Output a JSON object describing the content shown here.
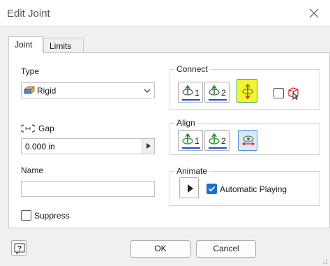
{
  "window": {
    "title": "Edit Joint"
  },
  "tabs": [
    {
      "label": "Joint",
      "active": true
    },
    {
      "label": "Limits",
      "active": false
    }
  ],
  "type_section": {
    "label": "Type",
    "selected": "Rigid"
  },
  "gap_section": {
    "label": "Gap",
    "value": "0.000 in"
  },
  "name_section": {
    "label": "Name",
    "value": ""
  },
  "suppress": {
    "label": "Suppress",
    "checked": false
  },
  "connect": {
    "label": "Connect",
    "buttons": [
      {
        "label": "1",
        "icon": "origin-1-icon"
      },
      {
        "label": "2",
        "icon": "origin-2-icon"
      },
      {
        "icon": "flip-component-icon",
        "active": true
      }
    ],
    "lock_checked": false
  },
  "align": {
    "label": "Align",
    "buttons": [
      {
        "label": "1",
        "icon": "align-1-icon"
      },
      {
        "label": "2",
        "icon": "align-2-icon"
      },
      {
        "icon": "invert-align-icon",
        "active": true
      }
    ]
  },
  "animate": {
    "label": "Animate",
    "auto_play_label": "Automatic Playing",
    "auto_play_checked": true
  },
  "footer": {
    "ok_label": "OK",
    "cancel_label": "Cancel"
  },
  "colors": {
    "accent": "#1f6fd1",
    "highlight": "#f2f531",
    "axis_green": "#2a8a2a",
    "axis_blue": "#2255cc",
    "axis_red": "#d42020"
  }
}
